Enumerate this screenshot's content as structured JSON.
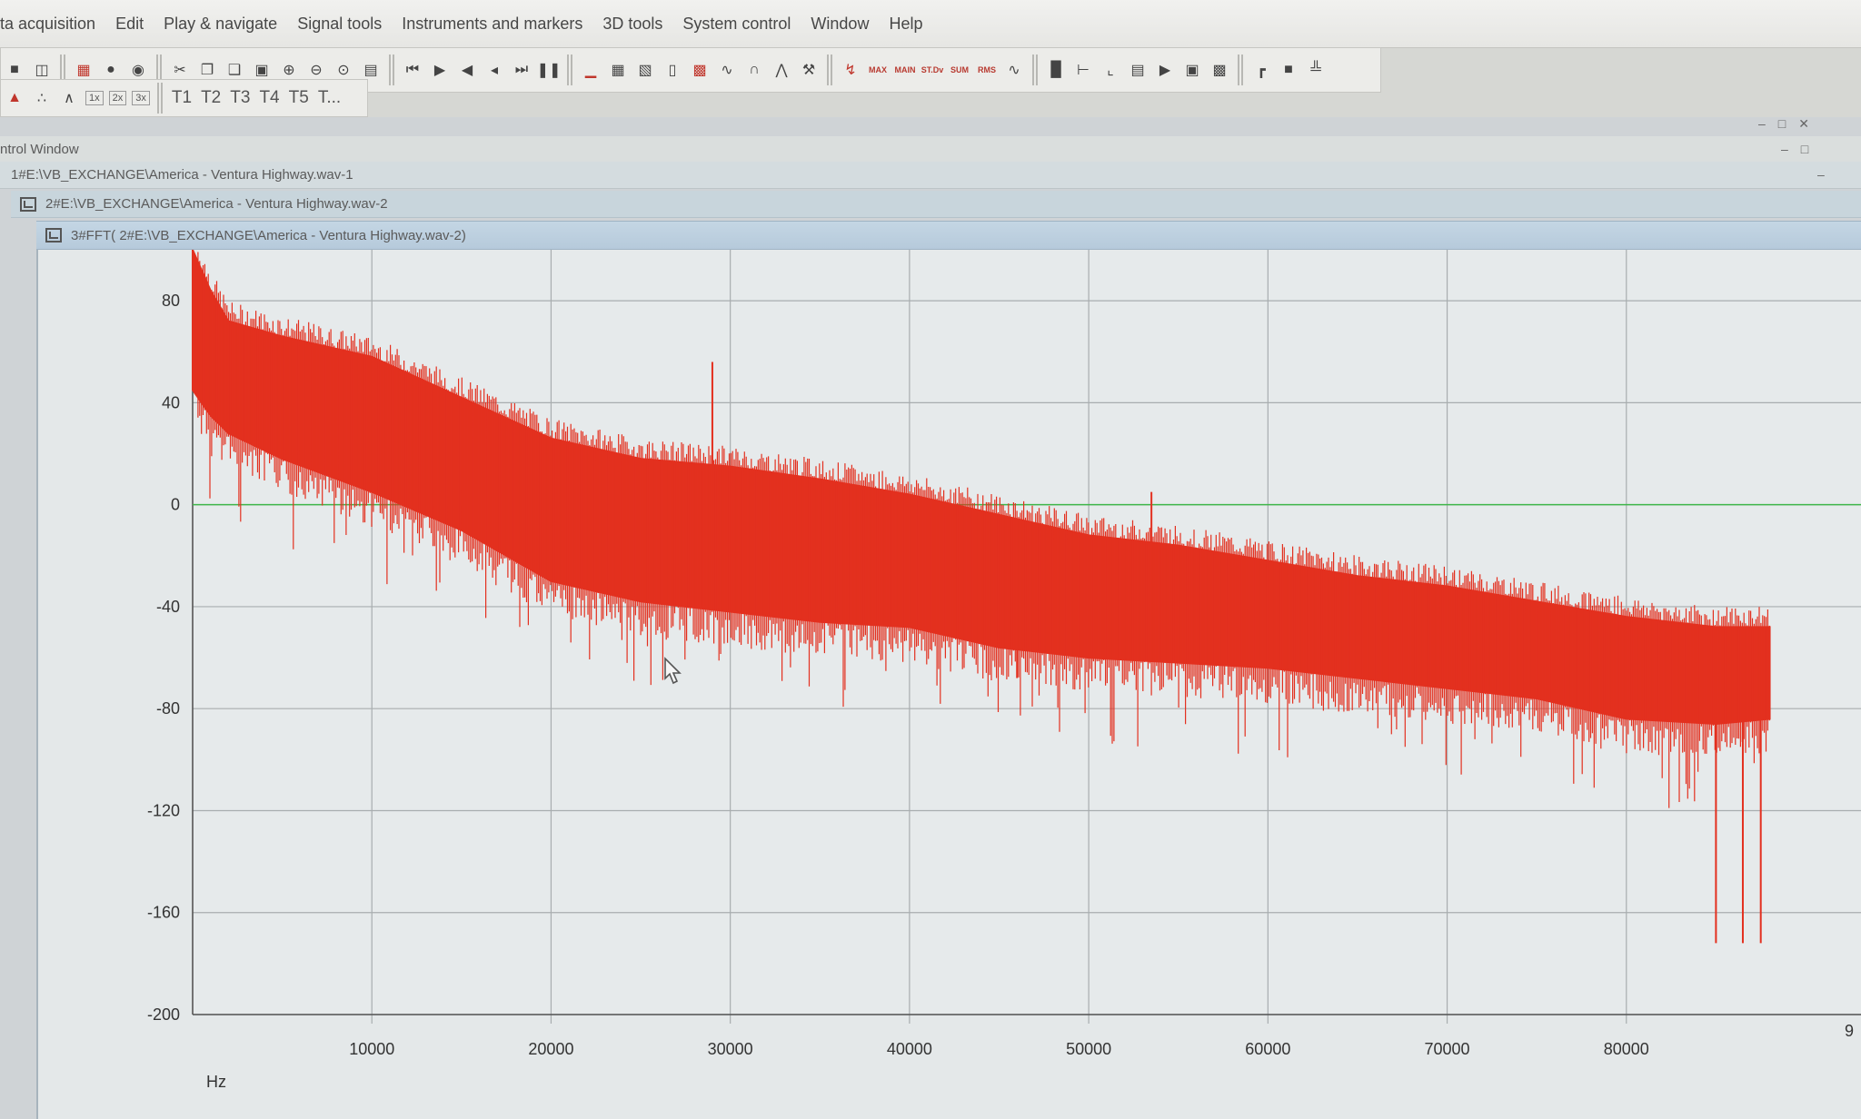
{
  "menu": {
    "items": [
      "ta acquisition",
      "Edit",
      "Play & navigate",
      "Signal tools",
      "Instruments and markers",
      "3D tools",
      "System control",
      "Window",
      "Help"
    ]
  },
  "toolbar": {
    "stat_buttons": [
      "MAX",
      "MAIN",
      "ST.Dv",
      "SUM",
      "RMS"
    ],
    "zoom_buttons": [
      "1x",
      "2x",
      "3x"
    ],
    "track_buttons": [
      "T1",
      "T2",
      "T3",
      "T4",
      "T5",
      "T..."
    ]
  },
  "windows": {
    "control": {
      "title": "ntrol Window"
    },
    "child1": {
      "title": "1#E:\\VB_EXCHANGE\\America - Ventura Highway.wav-1"
    },
    "child2": {
      "title": "2#E:\\VB_EXCHANGE\\America - Ventura Highway.wav-2"
    },
    "child3": {
      "title": "3#FFT( 2#E:\\VB_EXCHANGE\\America - Ventura Highway.wav-2)"
    }
  },
  "colors": {
    "signal": "#e3301f",
    "grid": "#a8adaf",
    "zero_line": "#3fb64a",
    "plot_bg": "#e6eaeb"
  },
  "chart_data": {
    "type": "area",
    "title": "",
    "xlabel": "Hz",
    "ylabel": "",
    "xlim": [
      0,
      90000
    ],
    "ylim": [
      -200,
      100
    ],
    "x_ticks": [
      10000,
      20000,
      30000,
      40000,
      50000,
      60000,
      70000,
      80000
    ],
    "x_tick_labels": [
      "10000",
      "20000",
      "30000",
      "40000",
      "50000",
      "60000",
      "70000",
      "80000",
      "9"
    ],
    "y_ticks": [
      80,
      40,
      0,
      -40,
      -80,
      -120,
      -160,
      -200
    ],
    "y_tick_labels": [
      "80",
      "40",
      "0",
      "-40",
      "-80",
      "-120",
      "-160",
      "-200"
    ],
    "grid": true,
    "reference_line_y": 0,
    "series": [
      {
        "upper_envelope": {
          "x": [
            0,
            1000,
            2000,
            5000,
            10000,
            15000,
            20000,
            25000,
            30000,
            35000,
            40000,
            45000,
            50000,
            55000,
            60000,
            65000,
            70000,
            75000,
            80000,
            85000,
            88000
          ],
          "y": [
            100,
            84,
            72,
            66,
            58,
            42,
            26,
            18,
            15,
            10,
            4,
            -4,
            -12,
            -16,
            -22,
            -28,
            -32,
            -38,
            -44,
            -48,
            -48
          ]
        },
        "lower_envelope": {
          "x": [
            0,
            1000,
            2000,
            5000,
            10000,
            15000,
            20000,
            25000,
            30000,
            35000,
            40000,
            45000,
            50000,
            55000,
            60000,
            65000,
            70000,
            75000,
            80000,
            85000,
            88000
          ],
          "y": [
            45,
            35,
            28,
            18,
            5,
            -10,
            -30,
            -38,
            -42,
            -46,
            -48,
            -56,
            -60,
            -62,
            -64,
            -68,
            -72,
            -76,
            -84,
            -86,
            -84
          ]
        },
        "spikes": [
          {
            "x": 29000,
            "y": 56
          },
          {
            "x": 53500,
            "y": 5
          },
          {
            "x": 46000,
            "y": -68
          },
          {
            "x": 85000,
            "y": -172
          },
          {
            "x": 86500,
            "y": -172
          },
          {
            "x": 87500,
            "y": -172
          }
        ]
      }
    ]
  }
}
